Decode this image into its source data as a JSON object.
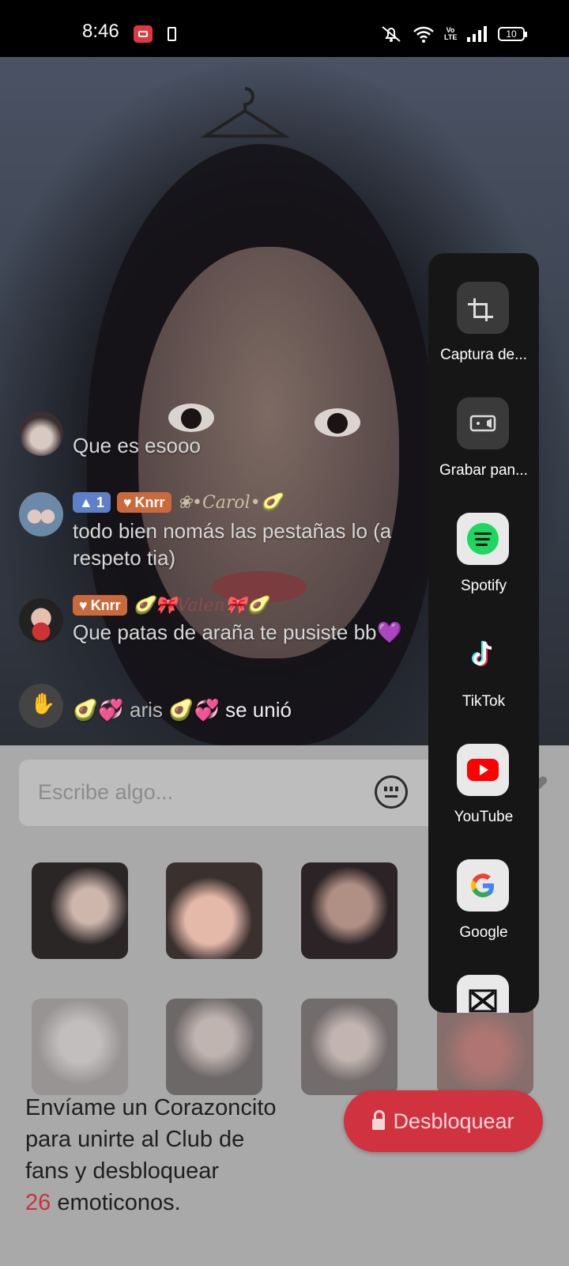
{
  "status_bar": {
    "time": "8:46",
    "battery": "10",
    "volte": "Vo LTE"
  },
  "chat": {
    "messages": [
      {
        "text": "Que es esooo"
      },
      {
        "badge_level": "1",
        "badge_fan": "Knrr",
        "nickname": "•Carol•",
        "text": "todo bien nomás las pestañas lo (a",
        "text2": "respeto tia)"
      },
      {
        "badge_fan": "Knrr",
        "nickname": "Valen",
        "text": "Que patas de araña te pusiste bb💜"
      },
      {
        "name": "aris",
        "text": "se unió"
      }
    ]
  },
  "input": {
    "placeholder": "Escribe algo..."
  },
  "unlock": {
    "line1": "Envíame un Corazoncito",
    "line2": "para unirte al Club de",
    "line3": "fans y desbloquear",
    "count": "26",
    "line4_suffix": " emoticonos.",
    "button_label": "Desbloquear"
  },
  "share_panel": {
    "items": [
      {
        "label": "Captura de...",
        "icon": "crop-icon"
      },
      {
        "label": "Grabar pan...",
        "icon": "screen-record-icon"
      },
      {
        "label": "Spotify",
        "icon": "spotify-icon"
      },
      {
        "label": "TikTok",
        "icon": "tiktok-icon"
      },
      {
        "label": "YouTube",
        "icon": "youtube-icon"
      },
      {
        "label": "Google",
        "icon": "google-icon"
      }
    ]
  },
  "colors": {
    "accent_red": "#d0333f",
    "panel_bg": "#161616",
    "bottom_bg": "#a9a9a9"
  }
}
